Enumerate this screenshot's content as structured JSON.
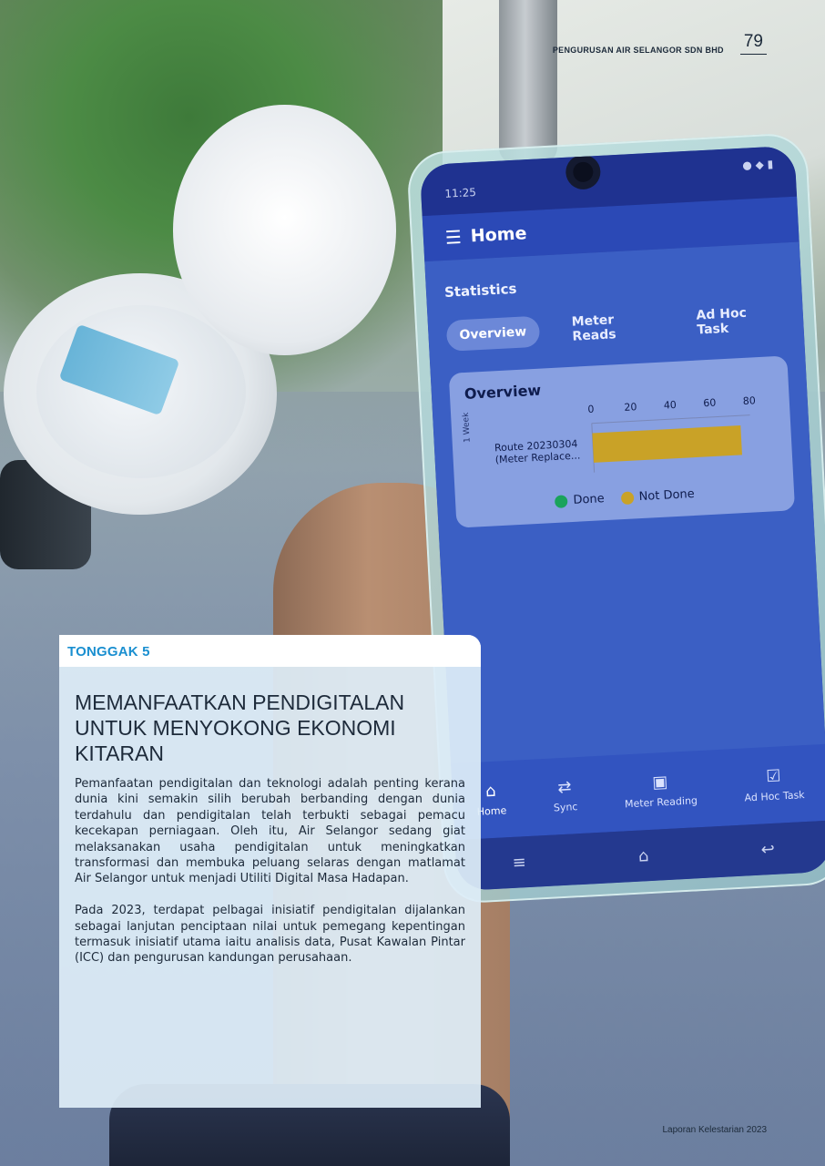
{
  "page_header": {
    "org_name": "PENGURUSAN AIR SELANGOR SDN BHD",
    "page_number": "79"
  },
  "footer": {
    "report_title": "Laporan Kelestarian 2023"
  },
  "pillar": {
    "label": "TONGGAK 5"
  },
  "section": {
    "heading": "MEMANFAATKAN PENDIGITALAN UNTUK MENYOKONG EKONOMI KITARAN",
    "paragraphs": [
      "Pemanfaatan pendigitalan dan teknologi adalah penting kerana dunia kini semakin silih berubah berbanding dengan dunia terdahulu dan pendigitalan telah terbukti sebagai pemacu kecekapan perniagaan. Oleh itu, Air Selangor sedang giat melaksanakan usaha pendigitalan untuk meningkatkan transformasi dan membuka peluang selaras dengan matlamat Air Selangor untuk menjadi Utiliti Digital Masa Hadapan.",
      "Pada 2023, terdapat pelbagai inisiatif pendigitalan dijalankan sebagai lanjutan penciptaan nilai untuk pemegang kepentingan termasuk inisiatif utama iaitu analisis data, Pusat Kawalan Pintar (ICC) dan pengurusan kandungan perusahaan."
    ]
  },
  "phone_app": {
    "status_time": "11:25",
    "header_title": "Home",
    "section_title": "Statistics",
    "tabs": [
      {
        "label": "Overview",
        "active": true
      },
      {
        "label": "Meter Reads",
        "active": false
      },
      {
        "label": "Ad Hoc Task",
        "active": false
      }
    ],
    "card_title": "Overview",
    "side_label": "1 Week",
    "bottom_nav": [
      {
        "label": "Home",
        "icon": "home-icon"
      },
      {
        "label": "Sync",
        "icon": "sync-icon"
      },
      {
        "label": "Meter Reading",
        "icon": "meter-reading-icon"
      },
      {
        "label": "Ad Hoc Task",
        "icon": "task-icon"
      }
    ]
  },
  "chart_data": {
    "type": "bar",
    "orientation": "horizontal",
    "categories": [
      "Route 20230304 (Meter Replace..."
    ],
    "series": [
      {
        "name": "Done",
        "values": [
          0
        ],
        "color": "#1aa35b"
      },
      {
        "name": "Not Done",
        "values": [
          75
        ],
        "color": "#c9a227"
      }
    ],
    "stacked": true,
    "xlim": [
      0,
      80
    ],
    "xticks": [
      0,
      20,
      40,
      60,
      80
    ],
    "legend_position": "bottom",
    "grid": false
  }
}
